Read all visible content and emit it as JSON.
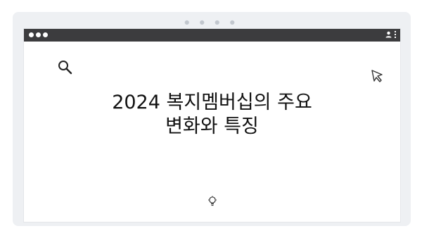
{
  "window": {
    "title_line1": "2024 복지멤버십의 주요",
    "title_line2": "변화와 특징"
  },
  "icons": {
    "search": "search-icon",
    "cursor": "cursor-icon",
    "bulb": "lightbulb-icon",
    "profile": "user-icon",
    "menu": "kebab-menu-icon"
  },
  "colors": {
    "titlebar": "#3c3c3e",
    "frame": "#eef0f3",
    "text": "#111111"
  }
}
